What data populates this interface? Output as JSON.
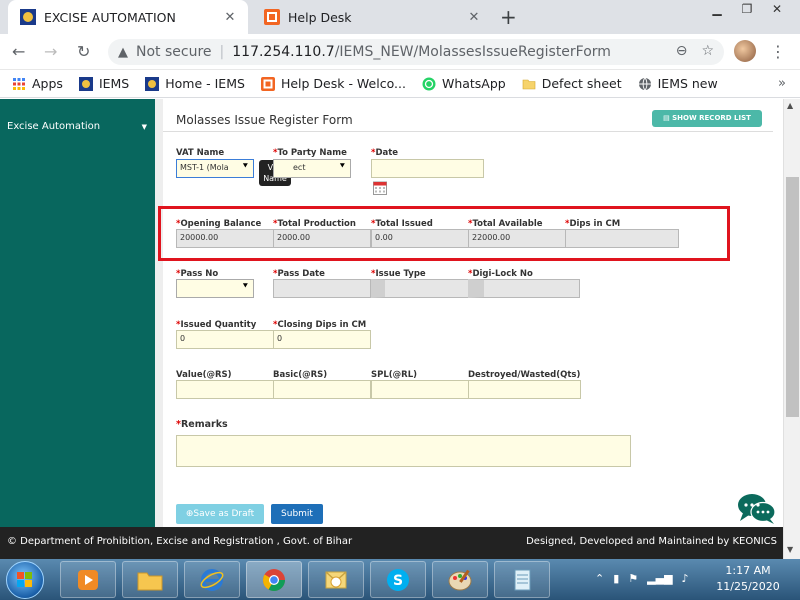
{
  "browser": {
    "tabs": [
      {
        "title": "EXCISE AUTOMATION",
        "icon": "iems-favicon"
      },
      {
        "title": "Help Desk",
        "icon": "helpdesk-favicon"
      }
    ],
    "new_tab": "+",
    "address": {
      "security": "Not secure",
      "host": "117.254.110.7",
      "path": "/IEMS_NEW/MolassesIssueRegisterForm"
    },
    "bookmarks": [
      {
        "label": "Apps",
        "icon": "apps-grid-icon"
      },
      {
        "label": "IEMS",
        "icon": "iems-favicon"
      },
      {
        "label": "Home - IEMS",
        "icon": "iems-favicon"
      },
      {
        "label": "Help Desk - Welco...",
        "icon": "helpdesk-favicon"
      },
      {
        "label": "WhatsApp",
        "icon": "whatsapp-icon"
      },
      {
        "label": "Defect sheet",
        "icon": "folder-icon"
      },
      {
        "label": "IEMS new",
        "icon": "globe-icon"
      }
    ]
  },
  "sidebar": {
    "items": [
      {
        "label": "Excise Automation",
        "caret": "▼"
      }
    ]
  },
  "form": {
    "title": "Molasses Issue Register Form",
    "show_record_btn": "SHOW RECORD LIST",
    "vat_name": {
      "label": "VAT Name",
      "value": "MST-1 (Mola"
    },
    "tooltip": "VAT Name",
    "to_party": {
      "req": "*",
      "label": "To Party Name",
      "value": "ect"
    },
    "date": {
      "req": "*",
      "label": "Date",
      "value": ""
    },
    "opening_balance": {
      "req": "*",
      "label": "Opening Balance",
      "value": "20000.00"
    },
    "total_production": {
      "req": "*",
      "label": "Total Production",
      "value": "2000.00"
    },
    "total_issued": {
      "req": "*",
      "label": "Total Issued",
      "value": "0.00"
    },
    "total_available": {
      "req": "*",
      "label": "Total Available",
      "value": "22000.00"
    },
    "dips_in_cm": {
      "req": "*",
      "label": "Dips in CM",
      "value": ""
    },
    "pass_no": {
      "req": "*",
      "label": "Pass No",
      "value": ""
    },
    "pass_date": {
      "req": "*",
      "label": "Pass Date",
      "value": ""
    },
    "issue_type": {
      "req": "*",
      "label": "Issue Type",
      "value": ""
    },
    "digi_lock": {
      "req": "*",
      "label": "Digi-Lock No",
      "value": ""
    },
    "issued_qty": {
      "req": "*",
      "label": "Issued Quantity",
      "value": "0"
    },
    "closing_dips": {
      "req": "*",
      "label": "Closing Dips in CM",
      "value": "0"
    },
    "value_rs": {
      "label": "Value(@RS)",
      "value": ""
    },
    "basic_rs": {
      "label": "Basic(@RS)",
      "value": ""
    },
    "spl_rl": {
      "label": "SPL(@RL)",
      "value": ""
    },
    "destroyed": {
      "label": "Destroyed/Wasted(Qts)",
      "value": ""
    },
    "remarks": {
      "req": "*",
      "label": "Remarks",
      "value": ""
    },
    "save_draft_btn": "Save as Draft",
    "submit_btn": "Submit"
  },
  "footer": {
    "left": "© Department of Prohibition, Excise and Registration , Govt. of Bihar",
    "right": "Designed, Developed and Maintained by KEONICS"
  },
  "taskbar": {
    "apps": [
      "media-player-icon",
      "file-explorer-icon",
      "internet-explorer-icon",
      "chrome-icon",
      "outlook-icon",
      "skype-icon",
      "paint-icon",
      "notepad-icon"
    ],
    "time": "1:17 AM",
    "date": "11/25/2020"
  },
  "colors": {
    "sidebar": "#08675e",
    "highlight_border": "#e0141e",
    "submit": "#1e6fb8",
    "draft": "#7fd0e3",
    "record_btn": "#4cb8a8"
  }
}
